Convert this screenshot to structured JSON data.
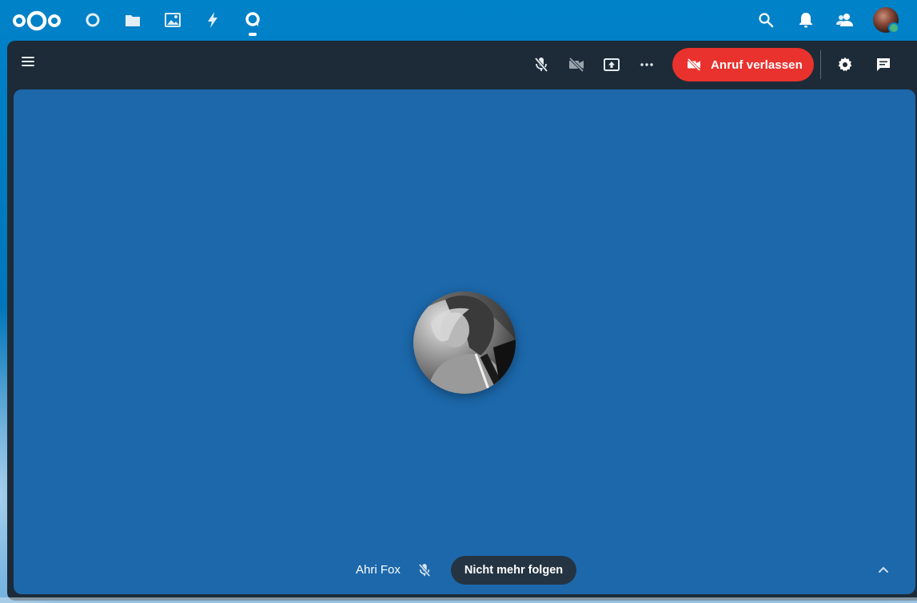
{
  "header": {
    "logo_icon": "nextcloud-logo",
    "apps": [
      {
        "name": "dashboard",
        "icon": "dashboard-circle-icon"
      },
      {
        "name": "files",
        "icon": "folder-icon"
      },
      {
        "name": "photos",
        "icon": "image-icon"
      },
      {
        "name": "activity",
        "icon": "lightning-icon"
      },
      {
        "name": "talk",
        "icon": "talk-icon",
        "active": true
      }
    ],
    "right_icons": [
      "search-icon",
      "bell-icon",
      "contacts-icon"
    ],
    "user_status_color": "#49b382"
  },
  "call": {
    "topbar": {
      "menu_icon": "hamburger-icon",
      "buttons": [
        "microphone-off-icon",
        "video-off-icon",
        "screen-share-icon",
        "more-icon"
      ],
      "leave_label": "Anruf verlassen",
      "leave_icon": "video-off-icon",
      "leave_color": "#e9322d",
      "right_buttons": [
        "gear-icon",
        "chat-icon"
      ]
    },
    "stage": {
      "background": "#1c68ab",
      "participant_name": "Ahri Fox",
      "participant_muted_icon": "microphone-off-icon",
      "unfollow_label": "Nicht mehr folgen",
      "collapse_icon": "chevron-up-icon"
    }
  }
}
